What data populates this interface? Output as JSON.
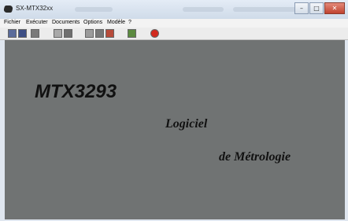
{
  "window": {
    "title": "SX-MTX32xx",
    "controls": {
      "minimize": "–",
      "maximize": "□",
      "close": "✕"
    }
  },
  "menu": {
    "items": [
      "Fichier",
      "Exécuter",
      "Documents",
      "Options",
      "Modèle",
      "?"
    ]
  },
  "toolbar": {
    "icons": [
      "open-file-icon",
      "save-file-icon",
      "print-icon",
      "config-icon",
      "measure-icon",
      "calibration-icon",
      "report-icon",
      "instrument-icon",
      "info-icon",
      "stop-icon"
    ],
    "colors": {
      "blue": "#2a4a9a",
      "red": "#c8201a",
      "green": "#3a7a2a",
      "gray": "#8a8a8a"
    }
  },
  "main": {
    "product": "MTX3293",
    "subtitle_line1": "Logiciel",
    "subtitle_line2": "de Métrologie"
  }
}
